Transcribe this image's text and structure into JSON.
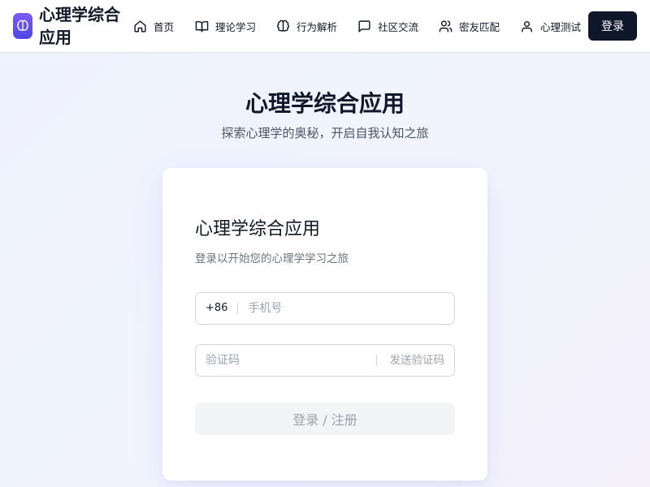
{
  "header": {
    "app_title": "心理学综合应用",
    "nav": [
      {
        "label": "首页",
        "icon": "home-icon"
      },
      {
        "label": "理论学习",
        "icon": "book-icon"
      },
      {
        "label": "行为解析",
        "icon": "brain-icon"
      },
      {
        "label": "社区交流",
        "icon": "chat-icon"
      },
      {
        "label": "密友匹配",
        "icon": "users-icon"
      },
      {
        "label": "心理测试",
        "icon": "user-icon"
      }
    ],
    "login_label": "登录"
  },
  "hero": {
    "title": "心理学综合应用",
    "subtitle": "探索心理学的奥秘，开启自我认知之旅"
  },
  "login_card": {
    "title": "心理学综合应用",
    "subtitle": "登录以开始您的心理学学习之旅",
    "phone_prefix": "+86",
    "phone_placeholder": "手机号",
    "phone_value": "",
    "code_placeholder": "验证码",
    "code_value": "",
    "send_code_label": "发送验证码",
    "submit_label": "登录 / 注册"
  },
  "colors": {
    "brand_gradient_start": "#7c5cf5",
    "brand_gradient_end": "#4f46e5",
    "primary_button": "#0f172a",
    "disabled_button": "#f3f4f6"
  }
}
